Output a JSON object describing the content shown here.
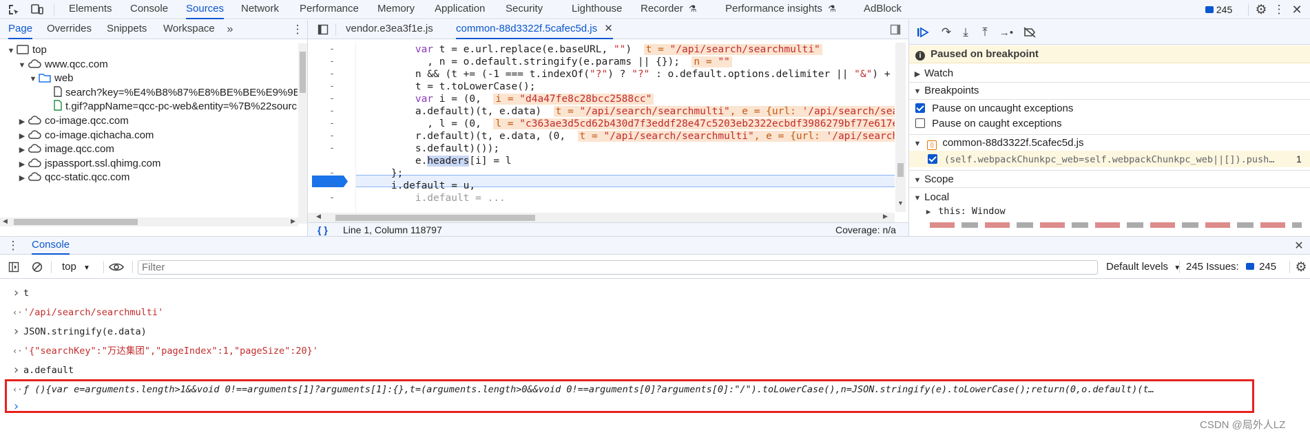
{
  "toolbar": {
    "tabs": [
      "Elements",
      "Console",
      "Sources",
      "Network",
      "Performance",
      "Memory",
      "Application",
      "Security",
      "Lighthouse",
      "Recorder",
      "Performance insights",
      "AdBlock"
    ],
    "issues_count": "245"
  },
  "navigator": {
    "tabs": [
      "Page",
      "Overrides",
      "Snippets",
      "Workspace"
    ],
    "tree": [
      {
        "label": "top",
        "depth": 0,
        "kind": "frame",
        "open": true
      },
      {
        "label": "www.qcc.com",
        "depth": 1,
        "kind": "cloud",
        "open": true
      },
      {
        "label": "web",
        "depth": 2,
        "kind": "folder",
        "open": true
      },
      {
        "label": "search?key=%E4%B8%87%E8%BE%BE%E9%9B%86",
        "depth": 3,
        "kind": "file"
      },
      {
        "label": "t.gif?appName=qcc-pc-web&entity=%7B%22sourc",
        "depth": 3,
        "kind": "file-green"
      },
      {
        "label": "co-image.qcc.com",
        "depth": 1,
        "kind": "cloud",
        "open": false
      },
      {
        "label": "co-image.qichacha.com",
        "depth": 1,
        "kind": "cloud",
        "open": false
      },
      {
        "label": "image.qcc.com",
        "depth": 1,
        "kind": "cloud",
        "open": false
      },
      {
        "label": "jspassport.ssl.qhimg.com",
        "depth": 1,
        "kind": "cloud",
        "open": false
      },
      {
        "label": "qcc-static.qcc.com",
        "depth": 1,
        "kind": "cloud",
        "open": false
      }
    ]
  },
  "editor": {
    "tabs": [
      "vendor.e3ea3f1e.js",
      "common-88d3322f.5cafec5d.js"
    ],
    "status_position": "Line 1, Column 118797",
    "status_coverage": "Coverage: n/a",
    "line_gutter": "-"
  },
  "debugger": {
    "paused_label": "Paused on breakpoint",
    "watch_label": "Watch",
    "breakpoints_label": "Breakpoints",
    "pause_uncaught": "Pause on uncaught exceptions",
    "pause_caught": "Pause on caught exceptions",
    "bp_file": "common-88d3322f.5cafec5d.js",
    "bp_code": "(self.webpackChunkpc_web=self.webpackChunkpc_web||[]).push…",
    "bp_line": "1",
    "scope_label": "Scope",
    "local_label": "Local",
    "this_label": "this: Window"
  },
  "drawer": {
    "tab": "Console",
    "context": "top",
    "filter_placeholder": "Filter",
    "levels": "Default levels",
    "issues_label": "245 Issues:",
    "issues_count": "245"
  },
  "console": {
    "entries": [
      {
        "dir": "in",
        "text": "t"
      },
      {
        "dir": "out",
        "text": "'/api/search/searchmulti'",
        "str": true
      },
      {
        "dir": "in",
        "text": "JSON.stringify(e.data)"
      },
      {
        "dir": "out",
        "text": "'{\"searchKey\":\"万达集团\",\"pageIndex\":1,\"pageSize\":20}'",
        "str": true
      },
      {
        "dir": "in",
        "text": "a.default"
      },
      {
        "dir": "out",
        "text": "ƒ (){var e=arguments.length>1&&void 0!==arguments[1]?arguments[1]:{},t=(arguments.length>0&&void 0!==arguments[0]?arguments[0]:\"/\").toLowerCase(),n=JSON.stringify(e).toLowerCase();return(0,o.default)(t…",
        "fn": true
      }
    ]
  },
  "watermark": "CSDN @局外人LZ"
}
